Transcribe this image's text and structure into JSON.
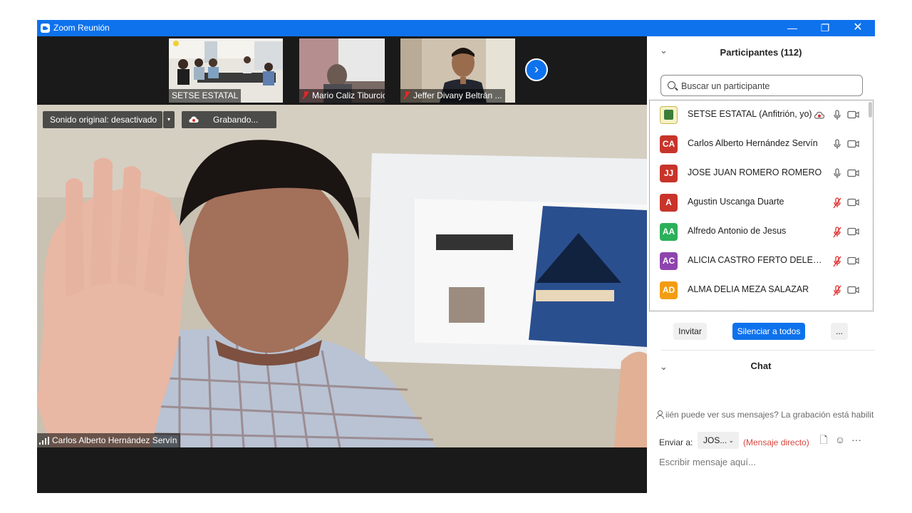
{
  "window": {
    "title": "Zoom Reunión",
    "minimize": "—",
    "restore": "❐",
    "close": "✕"
  },
  "thumbnails": [
    {
      "name": "SETSE ESTATAL",
      "muted": false
    },
    {
      "name": "Mario Caliz Tiburcio",
      "muted": true
    },
    {
      "name": "Jeffer Divany Beltrán ...",
      "muted": true
    }
  ],
  "next_arrow": "›",
  "main_video": {
    "sound_label": "Sonido original: desactivado",
    "sound_caret": "▾",
    "recording_label": "Grabando...",
    "speaker_name": "Carlos Alberto Hernández Servín"
  },
  "participants": {
    "title": "Participantes (112)",
    "collapse_glyph": "⌄",
    "search_placeholder": "Buscar un participante",
    "list": [
      {
        "initials": "",
        "color": "#f5f1c8",
        "name": "SETSE ESTATAL (Anfitrión, yo)",
        "recording": true,
        "muted": false
      },
      {
        "initials": "CA",
        "color": "#c8342a",
        "name": "Carlos Alberto Hernández Servín",
        "recording": false,
        "muted": false
      },
      {
        "initials": "JJ",
        "color": "#c8342a",
        "name": "JOSE JUAN ROMERO ROMERO",
        "recording": false,
        "muted": false
      },
      {
        "initials": "A",
        "color": "#c8342a",
        "name": "Agustin Uscanga Duarte",
        "recording": false,
        "muted": true
      },
      {
        "initials": "AA",
        "color": "#2bb05a",
        "name": "Alfredo Antonio de Jesus",
        "recording": false,
        "muted": true
      },
      {
        "initials": "AC",
        "color": "#8e44ad",
        "name": "ALICIA CASTRO FERTO DELEGACIÓN",
        "recording": false,
        "muted": true
      },
      {
        "initials": "AD",
        "color": "#f39c12",
        "name": "ALMA DELIA MEZA SALAZAR",
        "recording": false,
        "muted": true
      },
      {
        "initials": "",
        "color": "#16a085",
        "name": "",
        "recording": false,
        "muted": true
      }
    ],
    "invite_label": "Invitar",
    "mute_all_label": "Silenciar a todos",
    "more_label": "..."
  },
  "chat": {
    "title": "Chat",
    "notice": "iién puede ver sus mensajes? La grabación está habilit",
    "send_to_label": "Enviar a:",
    "send_to_value": "JOS...",
    "send_to_caret": "⌄",
    "direct_label": "(Mensaje directo)",
    "file_icon": "🗋",
    "emoji_icon": "☺",
    "more_icon": "···",
    "input_placeholder": "Escribir mensaje aquí..."
  }
}
